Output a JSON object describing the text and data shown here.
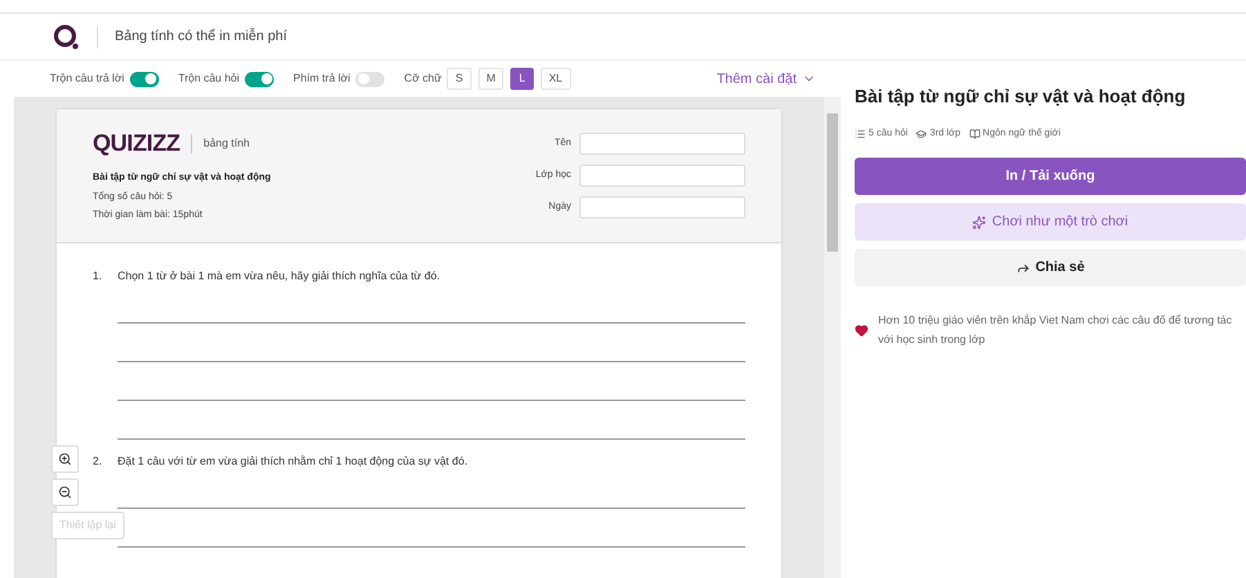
{
  "header": {
    "title": "Bảng tính có thể in miễn phí"
  },
  "toolbar": {
    "toggles": [
      {
        "label": "Trộn câu trả lời",
        "on": true
      },
      {
        "label": "Trộn câu hỏi",
        "on": true
      },
      {
        "label": "Phím trả lời",
        "on": false
      }
    ],
    "font_size_label": "Cỡ chữ",
    "font_sizes": [
      {
        "label": "S",
        "selected": false
      },
      {
        "label": "M",
        "selected": false
      },
      {
        "label": "L",
        "selected": true
      },
      {
        "label": "XL",
        "selected": false
      }
    ],
    "more_settings": "Thêm cài đặt"
  },
  "worksheet": {
    "brand": "QUIZIZZ",
    "brand_sub": "bảng tính",
    "title": "Bài tập từ ngữ chỉ sự vật và hoạt động",
    "total": "Tổng số câu hỏi: 5",
    "time": "Thời gian làm bài: 15phút",
    "fields": [
      {
        "label": "Tên"
      },
      {
        "label": "Lớp học"
      },
      {
        "label": "Ngày"
      }
    ],
    "questions": [
      {
        "number": "1.",
        "text": "Chọn 1 từ ở bài 1 mà em vừa nêu, hãy giải thích nghĩa của từ đó."
      },
      {
        "number": "2.",
        "text": "Đặt 1 câu với từ em vừa giải thích nhằm chỉ 1 hoạt động của sự vật đó."
      }
    ],
    "reset": "Thiết lập lại"
  },
  "panel": {
    "title": "Bài tập từ ngữ chỉ sự vật và hoạt động",
    "meta": [
      "5 câu hỏi",
      "3rd lớp",
      "Ngôn ngữ thế giới"
    ],
    "buttons": [
      {
        "kind": "primary",
        "label": "In / Tải xuống"
      },
      {
        "kind": "play",
        "label": "Chơi như một trò chơi"
      },
      {
        "kind": "share",
        "label": "Chia sẻ"
      }
    ],
    "note": "Hơn 10 triệu giáo viên trên khắp Viet Nam chơi các câu đố để tương tác với học sinh trong lớp"
  }
}
